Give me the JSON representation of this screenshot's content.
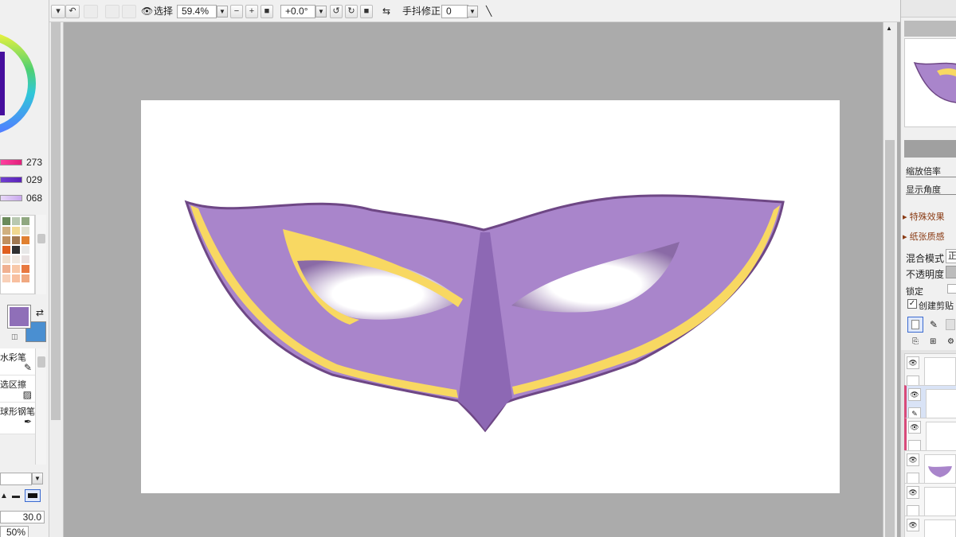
{
  "toolbar": {
    "undo_icon": "undo-icon",
    "select_label": "选择",
    "zoom_value": "59.4%",
    "rotation_value": "+0.0°",
    "stabilizer_label": "手抖修正",
    "stabilizer_value": "0"
  },
  "left_panel": {
    "sliders": [
      {
        "value": "273",
        "color": "#e0207a"
      },
      {
        "value": "029",
        "color": "#5a22b8"
      },
      {
        "value": "068",
        "color": "#c9a8ee"
      }
    ],
    "primary_color": "#8f6fb8",
    "secondary_color": "#4a8fd1",
    "tools": [
      {
        "label": "水彩笔",
        "icon": "brush-icon"
      },
      {
        "label": "选区擦",
        "icon": "selection-eraser-icon"
      },
      {
        "label": "球形钢笔",
        "icon": "pen-icon"
      }
    ],
    "brush_size": "30.0",
    "brush_density": "50%"
  },
  "right_panel": {
    "zoom_label": "缩放倍率",
    "angle_label": "显示角度",
    "effects_label": "特殊效果",
    "paper_label": "纸张质感",
    "blend_label": "混合模式",
    "blend_value": "正",
    "opacity_label": "不透明度",
    "lock_label": "锁定",
    "clip_label": "创建剪贴"
  },
  "colors": {
    "mask_fill": "#a985cb",
    "mask_center": "#8d68b4",
    "mask_outline": "#6e4785",
    "gold": "#f8d862",
    "canvas_bg": "#ababab"
  }
}
